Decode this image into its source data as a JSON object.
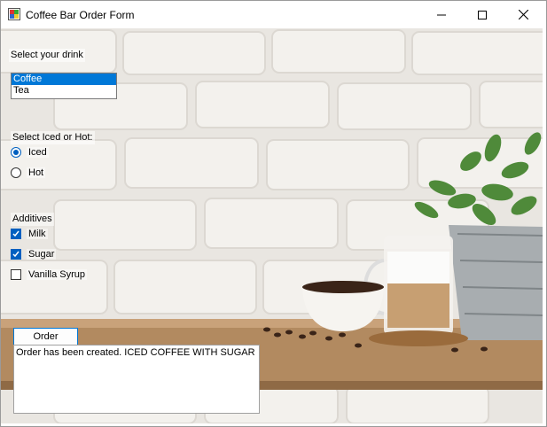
{
  "window": {
    "title": "Coffee Bar Order Form",
    "minimize_icon": "minimize-icon",
    "maximize_icon": "maximize-icon",
    "close_icon": "close-icon"
  },
  "drink": {
    "label": "Select your drink",
    "options": [
      "Coffee",
      "Tea"
    ],
    "selected": "Coffee"
  },
  "temperature": {
    "label": "Select Iced or Hot:",
    "options": [
      {
        "label": "Iced",
        "checked": true
      },
      {
        "label": "Hot",
        "checked": false
      }
    ]
  },
  "additives": {
    "label": "Additives",
    "options": [
      {
        "label": "Milk",
        "checked": true
      },
      {
        "label": "Sugar",
        "checked": true
      },
      {
        "label": "Vanilla Syrup",
        "checked": false
      }
    ]
  },
  "order": {
    "button_label": "Order",
    "output_text": "Order has been created.  ICED COFFEE WITH SUGAR"
  },
  "colors": {
    "accent": "#0078d7",
    "selection": "#0078d7"
  }
}
